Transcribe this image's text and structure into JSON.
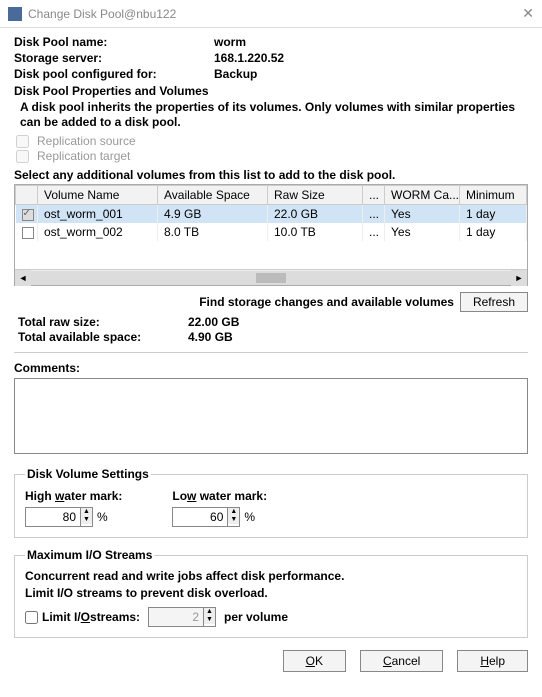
{
  "title": "Change Disk Pool@nbu122",
  "info": {
    "name_label": "Disk Pool name:",
    "name_value": "worm",
    "server_label": "Storage server:",
    "server_value": "168.1.220.52",
    "config_label": "Disk pool configured for:",
    "config_value": "Backup"
  },
  "props_heading": "Disk Pool Properties and Volumes",
  "props_desc": "A disk pool inherits the properties of its volumes. Only volumes with similar properties can be added to a disk pool.",
  "rep_source": "Replication source",
  "rep_target": "Replication target",
  "select_label": "Select any additional volumes from this list to add to the disk pool.",
  "columns": {
    "c0": "Volume Name",
    "c1": "Available Space",
    "c2": "Raw Size",
    "c3": "...",
    "c4": "WORM Ca...",
    "c5": "Minimum"
  },
  "rows": [
    {
      "checked": true,
      "name": "ost_worm_001",
      "avail": "4.9 GB",
      "raw": "22.0 GB",
      "ell": "...",
      "worm": "Yes",
      "min": "1 day"
    },
    {
      "checked": false,
      "name": "ost_worm_002",
      "avail": "8.0 TB",
      "raw": "10.0 TB",
      "ell": "...",
      "worm": "Yes",
      "min": "1 day"
    }
  ],
  "refresh_text": "Find storage changes and available volumes",
  "refresh_btn": "Refresh",
  "totals": {
    "raw_label": "Total raw size:",
    "raw_value": "22.00 GB",
    "avail_label": "Total available space:",
    "avail_value": "4.90 GB"
  },
  "comments_label": "Comments:",
  "dvs": {
    "legend": "Disk Volume Settings",
    "high_label": "High water mark:",
    "high_value": "80",
    "low_label": "Low water mark:",
    "low_value": "60",
    "pct": "%"
  },
  "io": {
    "legend": "Maximum I/O Streams",
    "line1": "Concurrent read and write jobs affect disk performance.",
    "line2": "Limit I/O streams to prevent disk overload.",
    "limit_label": "Limit I/O streams:",
    "limit_value": "2",
    "per": "per volume"
  },
  "buttons": {
    "ok": "OK",
    "cancel": "Cancel",
    "help": "Help"
  }
}
